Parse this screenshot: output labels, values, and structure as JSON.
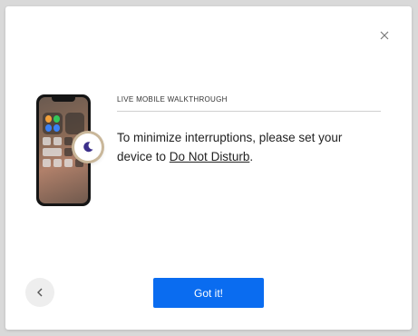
{
  "dialog": {
    "heading": "LIVE MOBILE WALKTHROUGH",
    "message_prefix": "To minimize interruptions, please set your device to ",
    "message_link": "Do Not Disturb",
    "message_suffix": ".",
    "primary_button_label": "Got it!",
    "close_icon": "close-icon",
    "back_icon": "chevron-left-icon",
    "illustration_icon": "moon-icon"
  },
  "colors": {
    "primary": "#0a6cf0",
    "moon": "#3b2f8a",
    "backdrop": "#d9d9d9"
  }
}
